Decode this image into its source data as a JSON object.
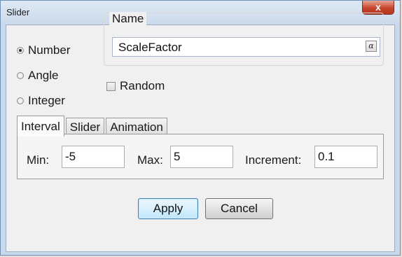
{
  "window": {
    "title": "Slider",
    "close_label": "x"
  },
  "type_options": [
    {
      "label": "Number",
      "checked": true
    },
    {
      "label": "Angle",
      "checked": false
    },
    {
      "label": "Integer",
      "checked": false
    }
  ],
  "name": {
    "label": "Name",
    "value": "ScaleFactor",
    "alpha_button": "α"
  },
  "random": {
    "label": "Random",
    "checked": false
  },
  "tabs": [
    {
      "label": "Interval",
      "active": true
    },
    {
      "label": "Slider",
      "active": false
    },
    {
      "label": "Animation",
      "active": false
    }
  ],
  "interval": {
    "min_label": "Min:",
    "min_value": "-5",
    "max_label": "Max:",
    "max_value": "5",
    "increment_label": "Increment:",
    "increment_value": "0.1"
  },
  "buttons": {
    "apply": "Apply",
    "cancel": "Cancel"
  },
  "colors": {
    "accent": "#3c7fb1",
    "close": "#c7442c",
    "title_bar": "#c9d8ea"
  }
}
